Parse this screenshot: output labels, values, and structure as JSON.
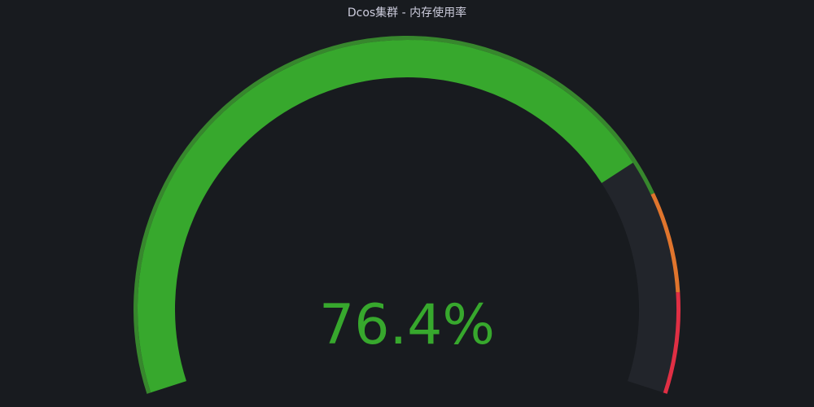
{
  "panel": {
    "title": "Dcos集群 - 内存使用率"
  },
  "chart_data": {
    "type": "gauge",
    "title": "Dcos集群 - 内存使用率",
    "value": 76.4,
    "display_value": "76.4%",
    "unit": "%",
    "min": 0,
    "max": 100,
    "thresholds": [
      {
        "from": 0,
        "to": 80,
        "color": "#37872d"
      },
      {
        "from": 80,
        "to": 90,
        "color": "#e0752d"
      },
      {
        "from": 90,
        "to": 100,
        "color": "#e02f44"
      }
    ],
    "value_color": "#37a82d",
    "track_color": "#22252b",
    "background": "#181b1f"
  }
}
